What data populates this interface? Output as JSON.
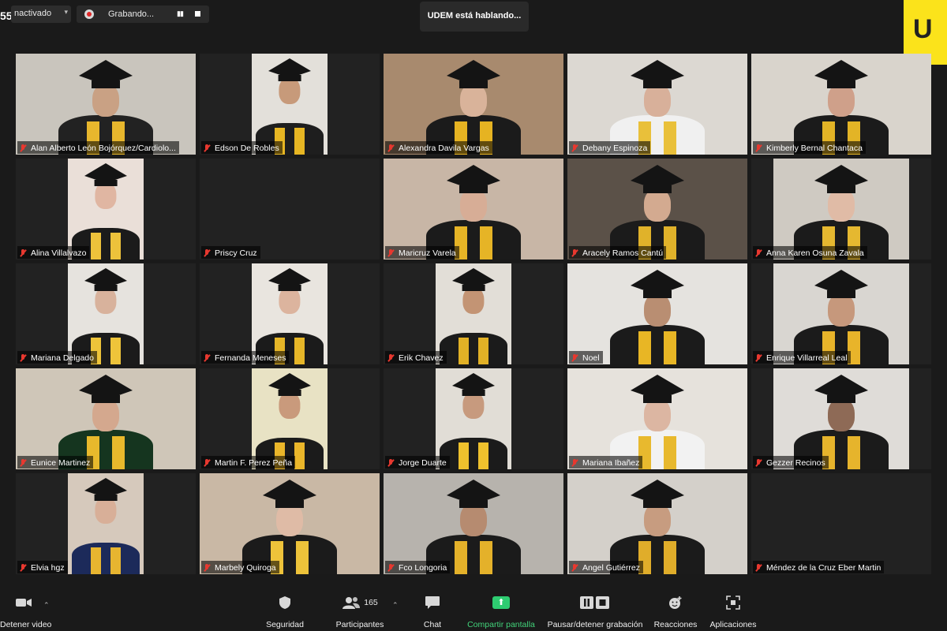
{
  "top": {
    "participant_count_partial": "55",
    "status_select": "nactivado",
    "recording_label": "Grabando...",
    "speaking": "UDEM está hablando...",
    "brand": "U"
  },
  "tiles": [
    {
      "name": "Alan Alberto León Bojórquez/Cardiolo...",
      "bg": "#c9c5bd",
      "skin": "#c9a184",
      "stole": "#e8b72d",
      "gown": "#222"
    },
    {
      "name": "Edson De Robles",
      "bg": "#e3e0da",
      "skin": "#c79a7a",
      "stole": "#e7b623",
      "gown": "#1e1e1e"
    },
    {
      "name": "Alexandra Davila Vargas",
      "bg": "#a88a6e",
      "skin": "#d9b39a",
      "stole": "#e6b322",
      "gown": "#1b1b1b"
    },
    {
      "name": "Debany Espinoza",
      "bg": "#dcd8d2",
      "skin": "#d8b09a",
      "stole": "#e9c03a",
      "gown": "#f0f0f0"
    },
    {
      "name": "Kimberly Bernal Chantaca",
      "bg": "#d9d4cc",
      "skin": "#cfa08a",
      "stole": "#e3b426",
      "gown": "#1b1b1b"
    },
    {
      "name": "Alina Villalvazo",
      "bg": "#eadfd8",
      "skin": "#e0b6a2",
      "stole": "#edc23b",
      "gown": "#1b1b1b"
    },
    {
      "name": "Priscy Cruz",
      "bg": "#222222",
      "skin": "",
      "stole": "",
      "gown": ""
    },
    {
      "name": "Maricruz Varela",
      "bg": "#c8b6a6",
      "skin": "#d7ad96",
      "stole": "#e6b426",
      "gown": "#1b1b1b"
    },
    {
      "name": "Aracely Ramos Cantú",
      "bg": "#5b5148",
      "skin": "#d3aa90",
      "stole": "#e0b22a",
      "gown": "#1b1b1b"
    },
    {
      "name": "Anna Karen Osuna Zavala",
      "bg": "#cfcac2",
      "skin": "#e0bba6",
      "stole": "#e5b830",
      "gown": "#1b1b1b"
    },
    {
      "name": "Mariana Delgado",
      "bg": "#e6e3de",
      "skin": "#d8b29c",
      "stole": "#eec43a",
      "gown": "#1b1b1b"
    },
    {
      "name": "Fernanda Meneses",
      "bg": "#e9e5df",
      "skin": "#dcb49e",
      "stole": "#e6b628",
      "gown": "#1b1b1b"
    },
    {
      "name": "Erik Chavez",
      "bg": "#e2ded7",
      "skin": "#c39474",
      "stole": "#e2b126",
      "gown": "#1b1b1b"
    },
    {
      "name": "Noel",
      "bg": "#e5e3df",
      "skin": "#b98e72",
      "stole": "#e8b625",
      "gown": "#1b1b1b"
    },
    {
      "name": "Enrique Villarreal Leal",
      "bg": "#d9d6d1",
      "skin": "#c6987c",
      "stole": "#e8b42a",
      "gown": "#1b1b1b"
    },
    {
      "name": "Eunice Martinez",
      "bg": "#cfc6b8",
      "skin": "#d4a88e",
      "stole": "#e8b92c",
      "gown": "#15351f"
    },
    {
      "name": "Martin F. Perez Peña",
      "bg": "#e8e2c4",
      "skin": "#c99a7c",
      "stole": "#eab62a",
      "gown": "#1b1b1b"
    },
    {
      "name": "Jorge Duarte",
      "bg": "#e1ddd6",
      "skin": "#c79a7e",
      "stole": "#efc12d",
      "gown": "#1b1b1b"
    },
    {
      "name": "Mariana Ibañez",
      "bg": "#e6e2dc",
      "skin": "#dcb6a2",
      "stole": "#e8b92e",
      "gown": "#f2f2f2"
    },
    {
      "name": "Gezzer Recinos",
      "bg": "#dfdcd8",
      "skin": "#8e6a56",
      "stole": "#e6b42c",
      "gown": "#1b1b1b"
    },
    {
      "name": "Elvia hgz",
      "bg": "#d6c9bc",
      "skin": "#d8af98",
      "stole": "#e7b530",
      "gown": "#1c2a5a"
    },
    {
      "name": "Marbely Quiroga",
      "bg": "#c9b8a5",
      "skin": "#dfbba6",
      "stole": "#eec33a",
      "gown": "#1b1b1b"
    },
    {
      "name": "Fco Longoria",
      "bg": "#b7b3ad",
      "skin": "#b68b70",
      "stole": "#e4b12a",
      "gown": "#1b1b1b"
    },
    {
      "name": "Angel Gutiérrez",
      "bg": "#d4d0ca",
      "skin": "#c79c80",
      "stole": "#e0ad2a",
      "gown": "#1b1b1b"
    },
    {
      "name": "Méndez de la Cruz Eber Martin",
      "bg": "#222222",
      "skin": "",
      "stole": "",
      "gown": ""
    }
  ],
  "toolbar": {
    "video": "Detener video",
    "security": "Seguridad",
    "participants": "Participantes",
    "participants_count": "165",
    "chat": "Chat",
    "share": "Compartir pantalla",
    "record": "Pausar/detener grabación",
    "reactions": "Reacciones",
    "apps": "Aplicaciones"
  },
  "colors": {
    "accent": "#2ecc71",
    "brand": "#fbe31b",
    "mic_off": "#e8382f"
  }
}
